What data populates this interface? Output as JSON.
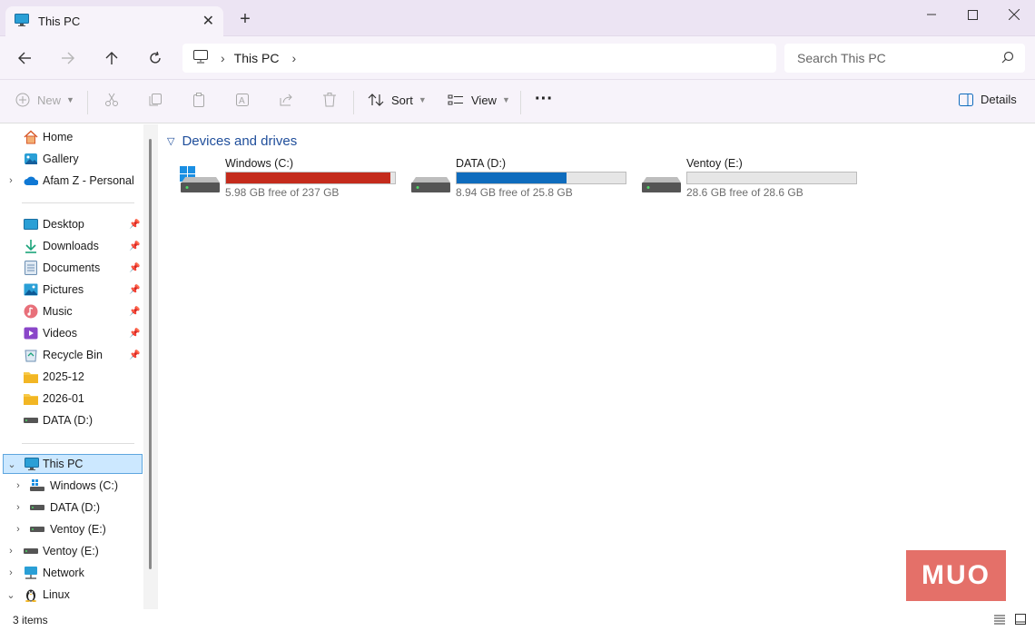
{
  "window": {
    "tab_title": "This PC",
    "new_tab": "+",
    "close_tab": "✕"
  },
  "address": {
    "crumb": "This PC",
    "search_placeholder": "Search This PC"
  },
  "toolbar": {
    "new_label": "New",
    "sort_label": "Sort",
    "view_label": "View",
    "more_label": "···",
    "details_label": "Details"
  },
  "sidebar": {
    "top": [
      {
        "label": "Home",
        "icon": "home-icon"
      },
      {
        "label": "Gallery",
        "icon": "gallery-icon"
      },
      {
        "label": "Afam Z - Personal",
        "icon": "onedrive-icon"
      }
    ],
    "pinned": [
      {
        "label": "Desktop",
        "icon": "desktop-icon"
      },
      {
        "label": "Downloads",
        "icon": "downloads-icon"
      },
      {
        "label": "Documents",
        "icon": "documents-icon"
      },
      {
        "label": "Pictures",
        "icon": "pictures-icon"
      },
      {
        "label": "Music",
        "icon": "music-icon"
      },
      {
        "label": "Videos",
        "icon": "videos-icon"
      },
      {
        "label": "Recycle Bin",
        "icon": "recycle-bin-icon"
      },
      {
        "label": "2025-12",
        "icon": "folder-icon"
      },
      {
        "label": "2026-01",
        "icon": "folder-icon"
      },
      {
        "label": "DATA (D:)",
        "icon": "drive-icon"
      }
    ],
    "tree": [
      {
        "label": "This PC",
        "icon": "pc-icon"
      },
      {
        "label": "Windows (C:)",
        "icon": "windows-drive-icon"
      },
      {
        "label": "DATA (D:)",
        "icon": "drive-icon"
      },
      {
        "label": "Ventoy (E:)",
        "icon": "drive-icon"
      },
      {
        "label": "Ventoy (E:)",
        "icon": "drive-icon"
      },
      {
        "label": "Network",
        "icon": "network-icon"
      },
      {
        "label": "Linux",
        "icon": "linux-icon"
      }
    ]
  },
  "main": {
    "group_title": "Devices and drives",
    "drives": [
      {
        "name": "Windows (C:)",
        "free": "5.98 GB free of 237 GB",
        "used_fraction": 0.975,
        "bar_color": "#c42b1c"
      },
      {
        "name": "DATA (D:)",
        "free": "8.94 GB free of 25.8 GB",
        "used_fraction": 0.653,
        "bar_color": "#0f6cbd"
      },
      {
        "name": "Ventoy (E:)",
        "free": "28.6 GB free of 28.6 GB",
        "used_fraction": 0.0,
        "bar_color": "#0f6cbd"
      }
    ]
  },
  "status": {
    "item_count": "3 items"
  },
  "watermark": {
    "text": "MUO"
  }
}
